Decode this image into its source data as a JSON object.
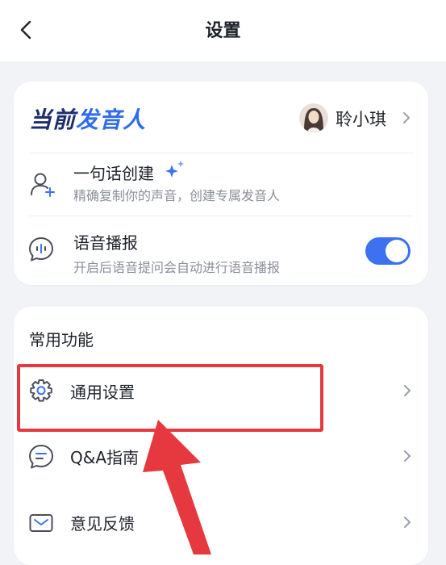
{
  "header": {
    "title": "设置"
  },
  "speaker": {
    "label_part1": "当前",
    "label_part2": "发音人",
    "name": "聆小琪"
  },
  "voice_create": {
    "title": "一句话创建",
    "subtitle": "精确复制你的声音，创建专属发音人"
  },
  "voice_broadcast": {
    "title": "语音播报",
    "subtitle": "开启后语音提问会自动进行语音播报",
    "enabled": true
  },
  "common_functions": {
    "title": "常用功能",
    "items": [
      {
        "label": "通用设置",
        "icon": "gear-icon"
      },
      {
        "label": "Q&A指南",
        "icon": "chat-bubble-icon"
      },
      {
        "label": "意见反馈",
        "icon": "mail-icon"
      }
    ]
  },
  "colors": {
    "accent": "#3c72f0",
    "annotation": "#e5393f",
    "brand_dark": "#1c2e6c"
  }
}
